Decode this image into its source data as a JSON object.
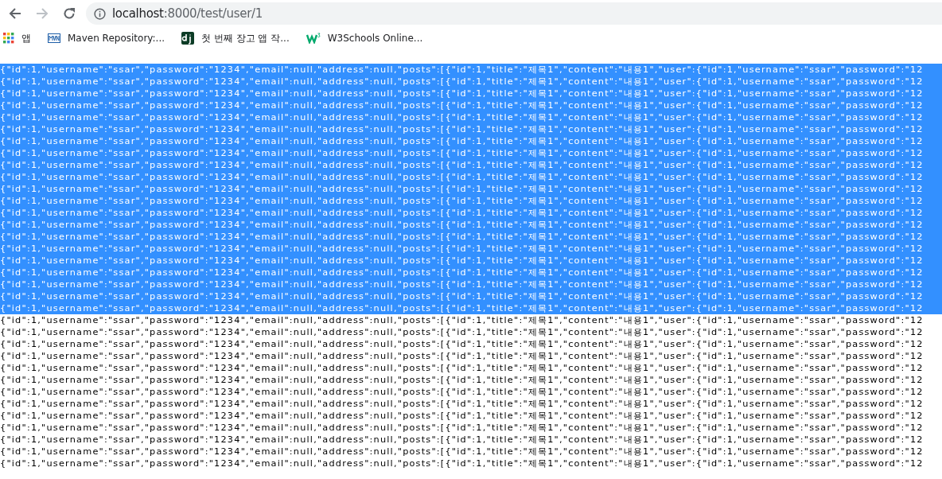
{
  "toolbar": {
    "buttons": [
      {
        "kind": "back",
        "disabled": false
      },
      {
        "kind": "forward",
        "disabled": true
      },
      {
        "kind": "reload",
        "disabled": false
      }
    ],
    "address": {
      "host": "localhost",
      "path": ":8000/test/user/1"
    }
  },
  "bookmarks": [
    {
      "label": "앱",
      "kind": "apps"
    },
    {
      "label": "Maven Repository:...",
      "kind": "mvn"
    },
    {
      "label": "첫 번째 장고 앱 작...",
      "kind": "dj"
    },
    {
      "label": "W3Schools Online...",
      "kind": "w3"
    }
  ],
  "body": {
    "lines": [
      {
        "text": "{\"id\":1,\"username\":\"ssar\",\"password\":\"1234\",\"email\":null,\"address\":null,\"posts\":[{\"id\":1,\"title\":\"제목1\",\"content\":\"내용1\",\"user\":{\"id\":1,\"username\":\"ssar\",\"password\":\"12",
        "selected": true
      },
      {
        "text": "{\"id\":1,\"username\":\"ssar\",\"password\":\"1234\",\"email\":null,\"address\":null,\"posts\":[{\"id\":1,\"title\":\"제목1\",\"content\":\"내용1\",\"user\":{\"id\":1,\"username\":\"ssar\",\"password\":\"12",
        "selected": true
      },
      {
        "text": "{\"id\":1,\"username\":\"ssar\",\"password\":\"1234\",\"email\":null,\"address\":null,\"posts\":[{\"id\":1,\"title\":\"제목1\",\"content\":\"내용1\",\"user\":{\"id\":1,\"username\":\"ssar\",\"password\":\"12",
        "selected": true
      },
      {
        "text": "{\"id\":1,\"username\":\"ssar\",\"password\":\"1234\",\"email\":null,\"address\":null,\"posts\":[{\"id\":1,\"title\":\"제목1\",\"content\":\"내용1\",\"user\":{\"id\":1,\"username\":\"ssar\",\"password\":\"12",
        "selected": true
      },
      {
        "text": "{\"id\":1,\"username\":\"ssar\",\"password\":\"1234\",\"email\":null,\"address\":null,\"posts\":[{\"id\":1,\"title\":\"제목1\",\"content\":\"내용1\",\"user\":{\"id\":1,\"username\":\"ssar\",\"password\":\"12",
        "selected": true
      },
      {
        "text": "{\"id\":1,\"username\":\"ssar\",\"password\":\"1234\",\"email\":null,\"address\":null,\"posts\":[{\"id\":1,\"title\":\"제목1\",\"content\":\"내용1\",\"user\":{\"id\":1,\"username\":\"ssar\",\"password\":\"12",
        "selected": true
      },
      {
        "text": "{\"id\":1,\"username\":\"ssar\",\"password\":\"1234\",\"email\":null,\"address\":null,\"posts\":[{\"id\":1,\"title\":\"제목1\",\"content\":\"내용1\",\"user\":{\"id\":1,\"username\":\"ssar\",\"password\":\"12",
        "selected": true
      },
      {
        "text": "{\"id\":1,\"username\":\"ssar\",\"password\":\"1234\",\"email\":null,\"address\":null,\"posts\":[{\"id\":1,\"title\":\"제목1\",\"content\":\"내용1\",\"user\":{\"id\":1,\"username\":\"ssar\",\"password\":\"12",
        "selected": true
      },
      {
        "text": "{\"id\":1,\"username\":\"ssar\",\"password\":\"1234\",\"email\":null,\"address\":null,\"posts\":[{\"id\":1,\"title\":\"제목1\",\"content\":\"내용1\",\"user\":{\"id\":1,\"username\":\"ssar\",\"password\":\"12",
        "selected": true
      },
      {
        "text": "{\"id\":1,\"username\":\"ssar\",\"password\":\"1234\",\"email\":null,\"address\":null,\"posts\":[{\"id\":1,\"title\":\"제목1\",\"content\":\"내용1\",\"user\":{\"id\":1,\"username\":\"ssar\",\"password\":\"12",
        "selected": true
      },
      {
        "text": "{\"id\":1,\"username\":\"ssar\",\"password\":\"1234\",\"email\":null,\"address\":null,\"posts\":[{\"id\":1,\"title\":\"제목1\",\"content\":\"내용1\",\"user\":{\"id\":1,\"username\":\"ssar\",\"password\":\"12",
        "selected": true
      },
      {
        "text": "{\"id\":1,\"username\":\"ssar\",\"password\":\"1234\",\"email\":null,\"address\":null,\"posts\":[{\"id\":1,\"title\":\"제목1\",\"content\":\"내용1\",\"user\":{\"id\":1,\"username\":\"ssar\",\"password\":\"12",
        "selected": true
      },
      {
        "text": "{\"id\":1,\"username\":\"ssar\",\"password\":\"1234\",\"email\":null,\"address\":null,\"posts\":[{\"id\":1,\"title\":\"제목1\",\"content\":\"내용1\",\"user\":{\"id\":1,\"username\":\"ssar\",\"password\":\"12",
        "selected": true
      },
      {
        "text": "{\"id\":1,\"username\":\"ssar\",\"password\":\"1234\",\"email\":null,\"address\":null,\"posts\":[{\"id\":1,\"title\":\"제목1\",\"content\":\"내용1\",\"user\":{\"id\":1,\"username\":\"ssar\",\"password\":\"12",
        "selected": true
      },
      {
        "text": "{\"id\":1,\"username\":\"ssar\",\"password\":\"1234\",\"email\":null,\"address\":null,\"posts\":[{\"id\":1,\"title\":\"제목1\",\"content\":\"내용1\",\"user\":{\"id\":1,\"username\":\"ssar\",\"password\":\"12",
        "selected": true
      },
      {
        "text": "{\"id\":1,\"username\":\"ssar\",\"password\":\"1234\",\"email\":null,\"address\":null,\"posts\":[{\"id\":1,\"title\":\"제목1\",\"content\":\"내용1\",\"user\":{\"id\":1,\"username\":\"ssar\",\"password\":\"12",
        "selected": true
      },
      {
        "text": "{\"id\":1,\"username\":\"ssar\",\"password\":\"1234\",\"email\":null,\"address\":null,\"posts\":[{\"id\":1,\"title\":\"제목1\",\"content\":\"내용1\",\"user\":{\"id\":1,\"username\":\"ssar\",\"password\":\"12",
        "selected": true
      },
      {
        "text": "{\"id\":1,\"username\":\"ssar\",\"password\":\"1234\",\"email\":null,\"address\":null,\"posts\":[{\"id\":1,\"title\":\"제목1\",\"content\":\"내용1\",\"user\":{\"id\":1,\"username\":\"ssar\",\"password\":\"12",
        "selected": true
      },
      {
        "text": "{\"id\":1,\"username\":\"ssar\",\"password\":\"1234\",\"email\":null,\"address\":null,\"posts\":[{\"id\":1,\"title\":\"제목1\",\"content\":\"내용1\",\"user\":{\"id\":1,\"username\":\"ssar\",\"password\":\"12",
        "selected": true
      },
      {
        "text": "{\"id\":1,\"username\":\"ssar\",\"password\":\"1234\",\"email\":null,\"address\":null,\"posts\":[{\"id\":1,\"title\":\"제목1\",\"content\":\"내용1\",\"user\":{\"id\":1,\"username\":\"ssar\",\"password\":\"12",
        "selected": true
      },
      {
        "text": "{\"id\":1,\"username\":\"ssar\",\"password\":\"1234\",\"email\":null,\"address\":null,\"posts\":[{\"id\":1,\"title\":\"제목1\",\"content\":\"내용1\",\"user\":{\"id\":1,\"username\":\"ssar\",\"password\":\"12",
        "selected": true
      },
      {
        "text": "{\"id\":1,\"username\":\"ssar\",\"password\":\"1234\",\"email\":null,\"address\":null,\"posts\":[{\"id\":1,\"title\":\"제목1\",\"content\":\"내용1\",\"user\":{\"id\":1,\"username\":\"ssar\",\"password\":\"12",
        "selected": false
      },
      {
        "text": "{\"id\":1,\"username\":\"ssar\",\"password\":\"1234\",\"email\":null,\"address\":null,\"posts\":[{\"id\":1,\"title\":\"제목1\",\"content\":\"내용1\",\"user\":{\"id\":1,\"username\":\"ssar\",\"password\":\"12",
        "selected": false
      },
      {
        "text": "{\"id\":1,\"username\":\"ssar\",\"password\":\"1234\",\"email\":null,\"address\":null,\"posts\":[{\"id\":1,\"title\":\"제목1\",\"content\":\"내용1\",\"user\":{\"id\":1,\"username\":\"ssar\",\"password\":\"12",
        "selected": false
      },
      {
        "text": "{\"id\":1,\"username\":\"ssar\",\"password\":\"1234\",\"email\":null,\"address\":null,\"posts\":[{\"id\":1,\"title\":\"제목1\",\"content\":\"내용1\",\"user\":{\"id\":1,\"username\":\"ssar\",\"password\":\"12",
        "selected": false
      },
      {
        "text": "{\"id\":1,\"username\":\"ssar\",\"password\":\"1234\",\"email\":null,\"address\":null,\"posts\":[{\"id\":1,\"title\":\"제목1\",\"content\":\"내용1\",\"user\":{\"id\":1,\"username\":\"ssar\",\"password\":\"12",
        "selected": false
      },
      {
        "text": "{\"id\":1,\"username\":\"ssar\",\"password\":\"1234\",\"email\":null,\"address\":null,\"posts\":[{\"id\":1,\"title\":\"제목1\",\"content\":\"내용1\",\"user\":{\"id\":1,\"username\":\"ssar\",\"password\":\"12",
        "selected": false
      },
      {
        "text": "{\"id\":1,\"username\":\"ssar\",\"password\":\"1234\",\"email\":null,\"address\":null,\"posts\":[{\"id\":1,\"title\":\"제목1\",\"content\":\"내용1\",\"user\":{\"id\":1,\"username\":\"ssar\",\"password\":\"12",
        "selected": false
      },
      {
        "text": "{\"id\":1,\"username\":\"ssar\",\"password\":\"1234\",\"email\":null,\"address\":null,\"posts\":[{\"id\":1,\"title\":\"제목1\",\"content\":\"내용1\",\"user\":{\"id\":1,\"username\":\"ssar\",\"password\":\"12",
        "selected": false
      },
      {
        "text": "{\"id\":1,\"username\":\"ssar\",\"password\":\"1234\",\"email\":null,\"address\":null,\"posts\":[{\"id\":1,\"title\":\"제목1\",\"content\":\"내용1\",\"user\":{\"id\":1,\"username\":\"ssar\",\"password\":\"12",
        "selected": false
      },
      {
        "text": "{\"id\":1,\"username\":\"ssar\",\"password\":\"1234\",\"email\":null,\"address\":null,\"posts\":[{\"id\":1,\"title\":\"제목1\",\"content\":\"내용1\",\"user\":{\"id\":1,\"username\":\"ssar\",\"password\":\"12",
        "selected": false
      },
      {
        "text": "{\"id\":1,\"username\":\"ssar\",\"password\":\"1234\",\"email\":null,\"address\":null,\"posts\":[{\"id\":1,\"title\":\"제목1\",\"content\":\"내용1\",\"user\":{\"id\":1,\"username\":\"ssar\",\"password\":\"12",
        "selected": false
      },
      {
        "text": "{\"id\":1,\"username\":\"ssar\",\"password\":\"1234\",\"email\":null,\"address\":null,\"posts\":[{\"id\":1,\"title\":\"제목1\",\"content\":\"내용1\",\"user\":{\"id\":1,\"username\":\"ssar\",\"password\":\"12",
        "selected": false
      },
      {
        "text": "{\"id\":1,\"username\":\"ssar\",\"password\":\"1234\",\"email\":null,\"address\":null,\"posts\":[{\"id\":1,\"title\":\"제목1\",\"content\":\"내용1\",\"user\":{\"id\":1,\"username\":\"ssar\",\"password\":\"12",
        "selected": false
      }
    ]
  }
}
